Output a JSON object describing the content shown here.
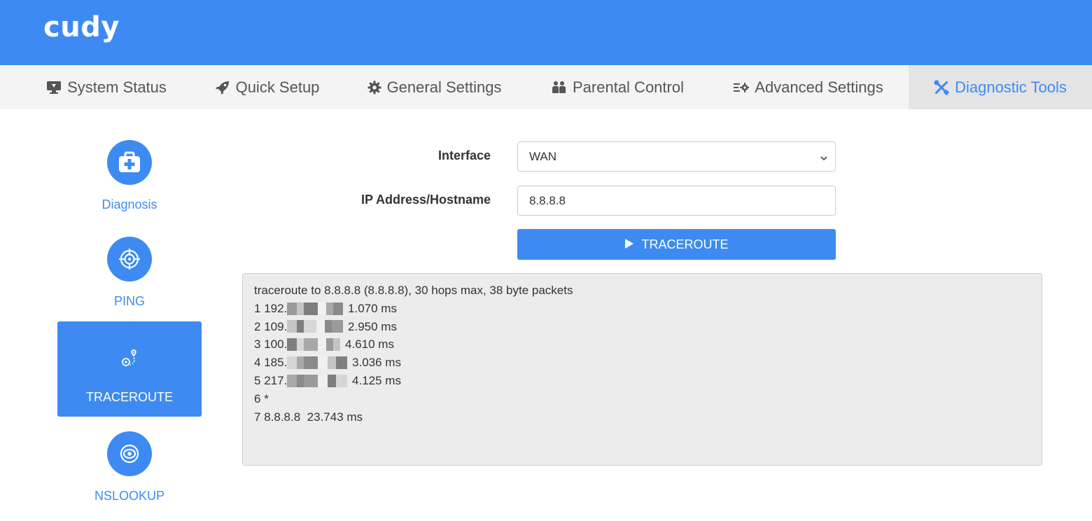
{
  "brand": {
    "logo_text": "cudy"
  },
  "nav": {
    "items": [
      {
        "label": "System Status",
        "icon": "monitor-icon"
      },
      {
        "label": "Quick Setup",
        "icon": "rocket-icon"
      },
      {
        "label": "General Settings",
        "icon": "gear-icon"
      },
      {
        "label": "Parental Control",
        "icon": "family-icon"
      },
      {
        "label": "Advanced Settings",
        "icon": "advanced-settings-icon"
      },
      {
        "label": "Diagnostic Tools",
        "icon": "tools-icon",
        "active": true
      }
    ]
  },
  "sidebar": {
    "items": [
      {
        "label": "Diagnosis",
        "icon": "first-aid-kit-icon"
      },
      {
        "label": "PING",
        "icon": "target-icon"
      },
      {
        "label": "TRACEROUTE",
        "icon": "route-icon",
        "active": true
      },
      {
        "label": "NSLOOKUP",
        "icon": "eye-icon"
      }
    ]
  },
  "form": {
    "interface_label": "Interface",
    "interface_value": "WAN",
    "host_label": "IP Address/Hostname",
    "host_value": "8.8.8.8",
    "run_label": "TRACEROUTE"
  },
  "output": {
    "header": "traceroute to 8.8.8.8 (8.8.8.8), 30 hops max, 38 byte packets",
    "hops": [
      {
        "num": "1",
        "prefix": "192.",
        "masked": true,
        "time": "1.070 ms"
      },
      {
        "num": "2",
        "prefix": "109.",
        "masked": true,
        "time": "2.950 ms"
      },
      {
        "num": "3",
        "prefix": "100.",
        "masked": true,
        "time": "4.610 ms"
      },
      {
        "num": "4",
        "prefix": "185.",
        "masked": true,
        "time": "3.036 ms"
      },
      {
        "num": "5",
        "prefix": "217.",
        "masked": true,
        "time": "4.125 ms"
      },
      {
        "num": "6",
        "prefix": "*",
        "masked": false,
        "time": ""
      },
      {
        "num": "7",
        "prefix": "8.8.8.8",
        "masked": false,
        "time": "23.743 ms"
      }
    ]
  },
  "colors": {
    "primary": "#3d8bf2",
    "nav_bg": "#f4f4f4",
    "nav_active_bg": "#e4e4e4",
    "output_bg": "#ececec"
  }
}
